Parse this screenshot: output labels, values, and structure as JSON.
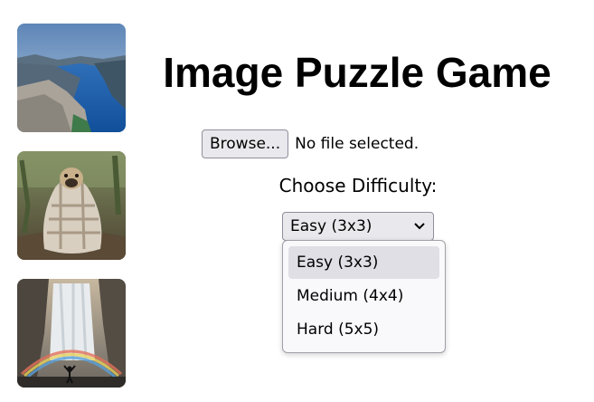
{
  "title": "Image Puzzle Game",
  "file_input": {
    "button_label": "Browse...",
    "status": "No file selected."
  },
  "difficulty": {
    "label": "Choose Difficulty:",
    "selected": "Easy (3x3)",
    "options": [
      "Easy (3x3)",
      "Medium (4x4)",
      "Hard (5x5)"
    ]
  },
  "thumbnails": [
    {
      "subject": "fjord-landscape"
    },
    {
      "subject": "pug-in-blanket"
    },
    {
      "subject": "waterfall-rainbow"
    }
  ],
  "colors": {
    "button_bg": "#e9e9ed",
    "border": "#8f8f9d",
    "option_highlight": "#e0dfe6"
  }
}
